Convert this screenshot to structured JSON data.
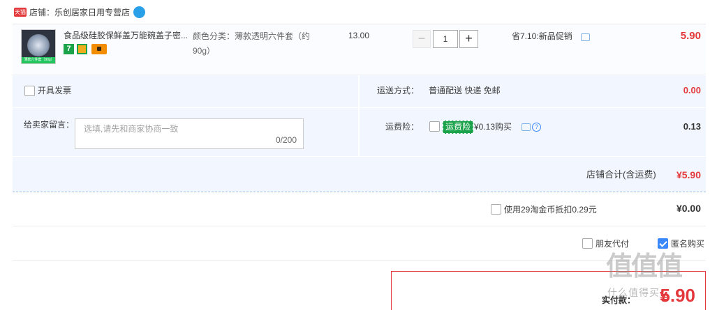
{
  "shop": {
    "badge": "天猫",
    "label": "店铺：乐创居家日用专营店"
  },
  "item": {
    "thumb_caption": "薄款六件套（90g）",
    "title": "食品级硅胶保鲜盖万能碗盖子密...",
    "sku": "颜色分类：薄款透明六件套（约90g）",
    "price": "13.00",
    "quantity": "1",
    "qty_minus": "−",
    "qty_plus": "+",
    "promo": "省7.10:新品促销",
    "subtotal": "5.90",
    "service_icons": [
      "seven-day-return-icon",
      "guarantee-icon",
      "credit-card-icon"
    ]
  },
  "options": {
    "invoice_label": "开具发票",
    "memo_label": "给卖家留言：",
    "memo_placeholder": "选填,请先和商家协商一致",
    "memo_count": "0/200",
    "shipping_label": "运送方式：",
    "shipping_value": "普通配送 快递 免邮",
    "shipping_fee": "0.00",
    "insurance_label": "运费险：",
    "insurance_badge": "运费险",
    "insurance_price": "¥0.13购买",
    "insurance_amount": "0.13"
  },
  "shop_total": {
    "label": "店铺合计(含运费)",
    "amount": "¥5.90"
  },
  "coin": {
    "label": "使用29淘金币抵扣0.29元",
    "amount": "¥0.00"
  },
  "extras": {
    "friend_pay_label": "朋友代付",
    "anonymous_label": "匿名购买",
    "anonymous_checked": true
  },
  "final": {
    "label": "实付款：",
    "symbol": "¥",
    "amount": "5.90"
  },
  "watermark": {
    "text": "值值值",
    "sub": "什么值得买"
  },
  "colors": {
    "accent_red": "#e4393c",
    "panel_bg": "#f2f7ff",
    "check_blue": "#3b88fd",
    "insurance_green": "#1aa34a"
  }
}
